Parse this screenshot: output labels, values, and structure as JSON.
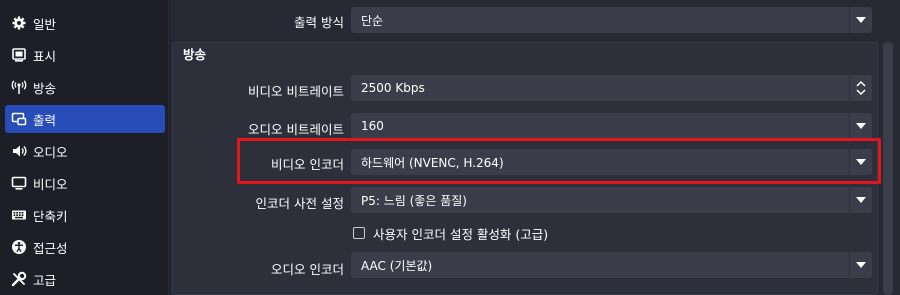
{
  "sidebar": {
    "items": [
      {
        "label": "일반",
        "icon": "gear-icon"
      },
      {
        "label": "표시",
        "icon": "display-icon"
      },
      {
        "label": "방송",
        "icon": "broadcast-icon"
      },
      {
        "label": "출력",
        "icon": "output-icon",
        "active": true
      },
      {
        "label": "오디오",
        "icon": "speaker-icon"
      },
      {
        "label": "비디오",
        "icon": "monitor-icon"
      },
      {
        "label": "단축키",
        "icon": "keyboard-icon"
      },
      {
        "label": "접근성",
        "icon": "accessibility-icon"
      },
      {
        "label": "고급",
        "icon": "wrench-icon"
      }
    ]
  },
  "settings": {
    "output_mode": {
      "label": "출력 방식",
      "value": "단순"
    },
    "section_title": "방송",
    "video_bitrate": {
      "label": "비디오 비트레이트",
      "value": "2500 Kbps"
    },
    "audio_bitrate": {
      "label": "오디오 비트레이트",
      "value": "160"
    },
    "video_encoder": {
      "label": "비디오 인코더",
      "value": "하드웨어 (NVENC, H.264)"
    },
    "encoder_preset": {
      "label": "인코더 사전 설정",
      "value": "P5: 느림 (좋은 품질)"
    },
    "custom_encoder_checkbox": {
      "label": "사용자 인코더 설정 활성화 (고급)",
      "checked": false
    },
    "audio_encoder": {
      "label": "오디오 인코더",
      "value": "AAC (기본값)"
    }
  },
  "colors": {
    "accent": "#284cb8",
    "highlight": "#e5151c",
    "field_bg": "#3b3e4a",
    "panel_bg": "#2d303b"
  }
}
